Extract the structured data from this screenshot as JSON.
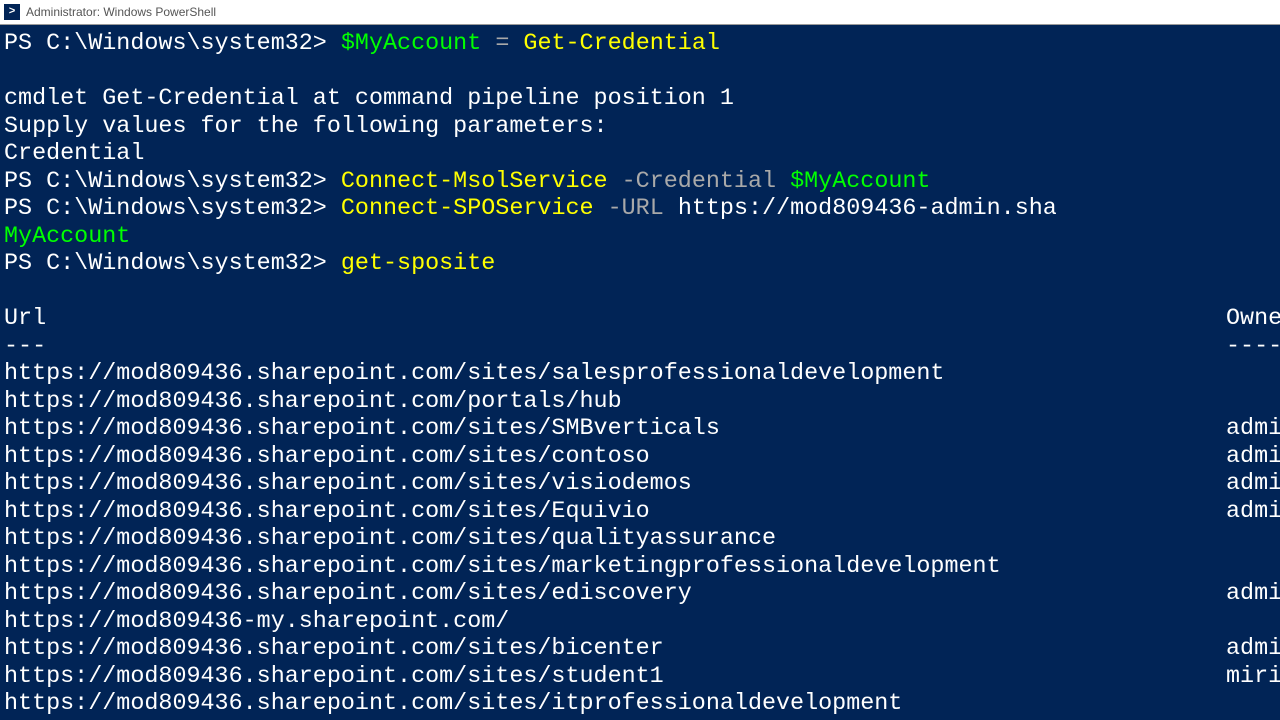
{
  "window": {
    "title": "Administrator: Windows PowerShell",
    "icon_text": ">"
  },
  "session": {
    "prompt": "PS C:\\Windows\\system32>",
    "lines": {
      "cmd1_var": "$MyAccount",
      "cmd1_op": "=",
      "cmd1_cmd": "Get-Credential",
      "cred_msg1": "cmdlet Get-Credential at command pipeline position 1",
      "cred_msg2": "Supply values for the following parameters:",
      "cred_msg3": "Credential",
      "cmd2_cmd": "Connect-MsolService",
      "cmd2_param": "-Credential",
      "cmd2_var": "$MyAccount",
      "cmd3_cmd": "Connect-SPOService",
      "cmd3_param": "-URL",
      "cmd3_url": "https://mod809436-admin.sha",
      "cmd3_wrap": "MyAccount",
      "cmd4_cmd": "get-sposite"
    },
    "output_headers": {
      "url": "Url",
      "owner": "Owne",
      "url_rule": "---",
      "owner_rule": "----"
    },
    "sites": [
      {
        "url": "https://mod809436.sharepoint.com/sites/salesprofessionaldevelopment",
        "owner": ""
      },
      {
        "url": "https://mod809436.sharepoint.com/portals/hub",
        "owner": ""
      },
      {
        "url": "https://mod809436.sharepoint.com/sites/SMBverticals",
        "owner": "admi"
      },
      {
        "url": "https://mod809436.sharepoint.com/sites/contoso",
        "owner": "admi"
      },
      {
        "url": "https://mod809436.sharepoint.com/sites/visiodemos",
        "owner": "admi"
      },
      {
        "url": "https://mod809436.sharepoint.com/sites/Equivio",
        "owner": "admi"
      },
      {
        "url": "https://mod809436.sharepoint.com/sites/qualityassurance",
        "owner": ""
      },
      {
        "url": "https://mod809436.sharepoint.com/sites/marketingprofessionaldevelopment",
        "owner": ""
      },
      {
        "url": "https://mod809436.sharepoint.com/sites/ediscovery",
        "owner": "admi"
      },
      {
        "url": "https://mod809436-my.sharepoint.com/",
        "owner": ""
      },
      {
        "url": "https://mod809436.sharepoint.com/sites/bicenter",
        "owner": "admi"
      },
      {
        "url": "https://mod809436.sharepoint.com/sites/student1",
        "owner": "miri"
      },
      {
        "url": "https://mod809436.sharepoint.com/sites/itprofessionaldevelopment",
        "owner": ""
      }
    ]
  }
}
